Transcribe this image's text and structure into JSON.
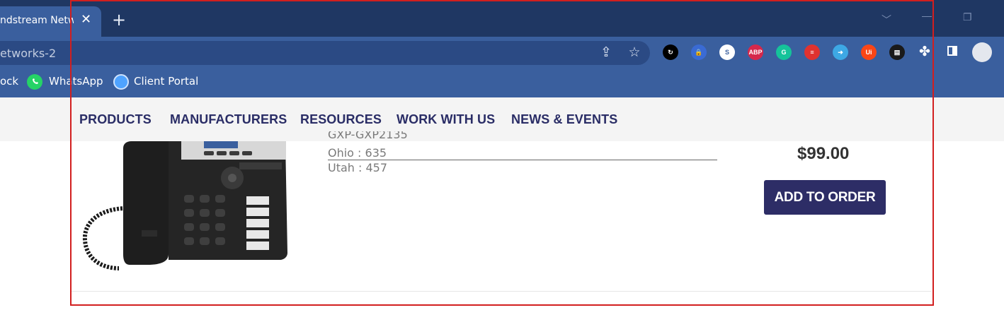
{
  "browser": {
    "tab_title": "ndstream Netwo",
    "tab_close": "✕",
    "new_tab": "+",
    "url": "etworks-2",
    "bookmarks": [
      {
        "label": "ock"
      },
      {
        "label": "WhatsApp",
        "icon": "whatsapp-icon"
      },
      {
        "label": "Client Portal",
        "icon": "globe-icon"
      }
    ],
    "extensions": [
      {
        "name": "sync-icon",
        "text": "↻",
        "color": "#000000"
      },
      {
        "name": "vpn-icon",
        "text": "🔒",
        "color": "#3a6bd4"
      },
      {
        "name": "s-extension-icon",
        "text": "S",
        "color": "#ffffff"
      },
      {
        "name": "adblock-icon",
        "text": "ABP",
        "color": "#d6284b"
      },
      {
        "name": "grammarly-icon",
        "text": "G",
        "color": "#15c39a"
      },
      {
        "name": "flag-icon",
        "text": "≡",
        "color": "#e0322f"
      },
      {
        "name": "screenshot-icon",
        "text": "➜",
        "color": "#3da8e5"
      },
      {
        "name": "uipath-icon",
        "text": "Ui",
        "color": "#fa4616"
      },
      {
        "name": "document-icon",
        "text": "▤",
        "color": "#1a1a1a"
      }
    ]
  },
  "nav": {
    "items": [
      "PRODUCTS",
      "MANUFACTURERS",
      "RESOURCES",
      "WORK WITH US",
      "NEWS & EVENTS"
    ]
  },
  "product": {
    "cut_text": "GXP-GXP2135",
    "specs": [
      "Ohio : 635",
      "Utah : 457"
    ],
    "price": "$99.00",
    "add_label": "ADD TO ORDER"
  }
}
